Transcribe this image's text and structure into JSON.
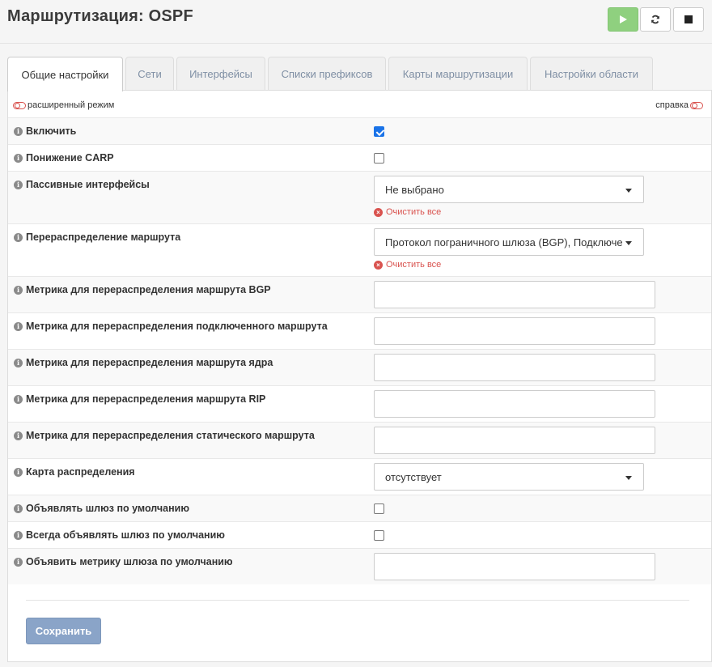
{
  "header": {
    "title": "Маршрутизация: OSPF",
    "buttons": {
      "start": "play-icon",
      "restart": "reload-icon",
      "stop": "stop-icon"
    },
    "start_color": "#8fd07f"
  },
  "tabs": [
    {
      "label": "Общие настройки",
      "active": true
    },
    {
      "label": "Сети"
    },
    {
      "label": "Интерфейсы"
    },
    {
      "label": "Списки префиксов"
    },
    {
      "label": "Карты маршрутизации"
    },
    {
      "label": "Настройки области"
    }
  ],
  "form": {
    "advanced_mode": "расширенный режим",
    "help": "справка",
    "clear_all": "Очистить все",
    "fields": {
      "enable": {
        "label": "Включить",
        "checked": true
      },
      "carp": {
        "label": "Понижение CARP",
        "checked": false
      },
      "passive": {
        "label": "Пассивные интерфейсы",
        "value": "Не выбрано"
      },
      "redistribute": {
        "label": "Перераспределение маршрута",
        "value": "Протокол пограничного шлюза (BGP), Подключенные маршруты"
      },
      "bgp_metric": {
        "label": "Метрика для перераспределения маршрута BGP",
        "value": ""
      },
      "connected_metric": {
        "label": "Метрика для перераспределения подключенного маршрута",
        "value": ""
      },
      "kernel_metric": {
        "label": "Метрика для перераспределения маршрута ядра",
        "value": ""
      },
      "rip_metric": {
        "label": "Метрика для перераспределения маршрута RIP",
        "value": ""
      },
      "static_metric": {
        "label": "Метрика для перераспределения статического маршрута",
        "value": ""
      },
      "distribute_map": {
        "label": "Карта распределения",
        "value": "отсутствует"
      },
      "originate_default": {
        "label": "Объявлять шлюз по умолчанию",
        "checked": false
      },
      "always_originate": {
        "label": "Всегда объявлять шлюз по умолчанию",
        "checked": false
      },
      "default_metric": {
        "label": "Объявить метрику шлюза по умолчанию",
        "value": ""
      }
    }
  },
  "save_label": "Сохранить"
}
